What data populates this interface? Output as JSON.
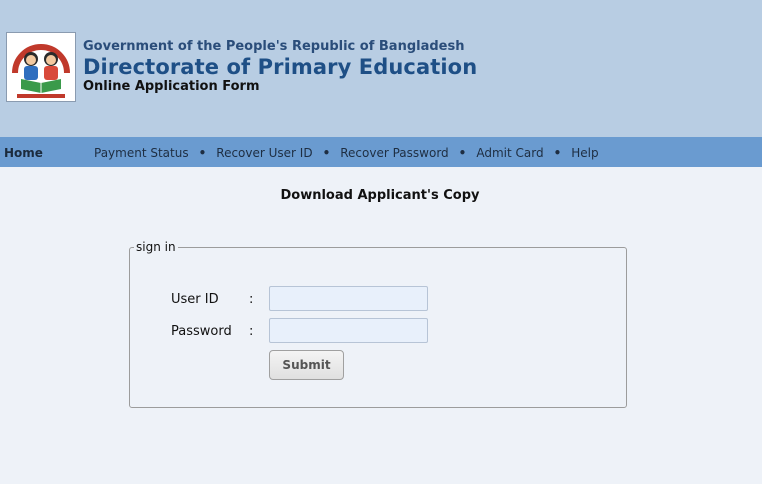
{
  "header": {
    "government": "Government of the People's Republic of Bangladesh",
    "title": "Directorate of Primary Education",
    "subtitle": "Online Application Form"
  },
  "nav": {
    "home": "Home",
    "items": [
      "Payment Status",
      "Recover User ID",
      "Recover Password",
      "Admit Card",
      "Help"
    ],
    "separator": "•"
  },
  "page_title": "Download Applicant's Copy",
  "signin": {
    "legend": "sign in",
    "user_id_label": "User ID",
    "password_label": "Password",
    "colon": ":",
    "user_id_value": "",
    "password_value": "",
    "submit_label": "Submit"
  },
  "colors": {
    "header_bg": "#b8cde3",
    "nav_bg": "#6a9bd0",
    "page_bg": "#eef2f8",
    "title_blue": "#1e4f86"
  },
  "icons": {
    "logo": "dpe-logo-children-reading"
  }
}
